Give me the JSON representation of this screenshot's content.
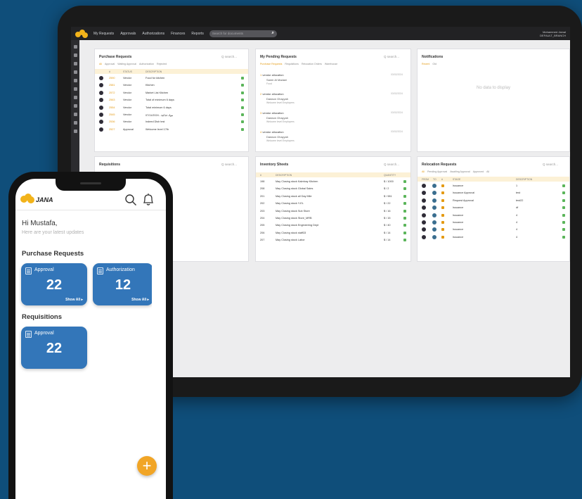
{
  "desktop": {
    "nav": [
      "My Requests",
      "Approvals",
      "Authorizations",
      "Finances",
      "Reports"
    ],
    "search_placeholder": "Search for documents",
    "user": [
      "Mohammed Jamal",
      "DEFAULT_BRANCH"
    ],
    "purchase_requests": {
      "title": "Purchase Requests",
      "search": "Q search...",
      "filters": [
        "All",
        "Approval",
        "Waiting Approval",
        "Authorization",
        "Rejected"
      ],
      "columns": [
        "#",
        "STATUS",
        "DESCRIPTION"
      ],
      "rows": [
        {
          "no": "2590",
          "status": "Vendor",
          "desc": "Food for kitchen"
        },
        {
          "no": "2581",
          "status": "Vendor",
          "desc": "Kitchen"
        },
        {
          "no": "2572",
          "status": "Vendor",
          "desc": "Market List Kitchen"
        },
        {
          "no": "2563",
          "status": "Vendor",
          "desc": "Total of minimum 6 days"
        },
        {
          "no": "2554",
          "status": "Vendor",
          "desc": "Total minimum 6 days"
        },
        {
          "no": "2545",
          "status": "Vendor",
          "desc": "07/11/2024 - مواد غذائية"
        },
        {
          "no": "2536",
          "status": "Vendor",
          "desc": "Indeed Dish test"
        },
        {
          "no": "2527",
          "status": "Approval",
          "desc": "Welcome level 17th"
        }
      ]
    },
    "pending": {
      "title": "My Pending Requests",
      "search": "Q search...",
      "filters": [
        "Purchase Requests",
        "Requisitions",
        "Relocation Orders",
        "Warehouse"
      ],
      "items": [
        {
          "code": "1",
          "title": "vendor allocation",
          "name": "Samir Al Madani",
          "note": "Food",
          "date": "03/02/2024"
        },
        {
          "code": "2",
          "title": "vendor allocation",
          "name": "Dadaon Ghayyah",
          "note": "Welcome level Employees",
          "date": "03/02/2024"
        },
        {
          "code": "3",
          "title": "vendor allocation",
          "name": "Dadaon Ghayyah",
          "note": "Welcome level Employees",
          "date": "03/02/2024"
        },
        {
          "code": "4",
          "title": "vendor allocation",
          "name": "Dadaon Ghayyah",
          "note": "Welcome level Employees",
          "date": "03/02/2024"
        }
      ]
    },
    "notifications": {
      "title": "Notifications",
      "tabs": [
        "Recent",
        "Old"
      ],
      "empty": "No data to display"
    },
    "requisitions": {
      "title": "Requisitions",
      "search": "Q search..."
    },
    "inventory": {
      "title": "Inventory Sheets",
      "search": "Q search...",
      "columns": [
        "#",
        "DESCRIPTION",
        "QUANTITY"
      ],
      "rows": [
        {
          "no": "198",
          "desc": "May Closing stock Kalmbay Kitchen",
          "qty": "$ / 1000"
        },
        {
          "no": "208",
          "desc": "May Closing stock Global Sales",
          "qty": "$ / 2"
        },
        {
          "no": "201",
          "desc": "May Closing stock all Day Mile",
          "qty": "$ / 981"
        },
        {
          "no": "202",
          "desc": "May Closing stock Y-EL",
          "qty": "$ / 22"
        },
        {
          "no": "203",
          "desc": "May Closing stock Sub Store",
          "qty": "$ / 16"
        },
        {
          "no": "204",
          "desc": "May Closing stock Store_MRB",
          "qty": "$ / 15"
        },
        {
          "no": "205",
          "desc": "May Closing stock Engineering Dept",
          "qty": "$ / 40"
        },
        {
          "no": "206",
          "desc": "May Closing stock staff33",
          "qty": "$ / 14"
        },
        {
          "no": "207",
          "desc": "May Closing stock Labor",
          "qty": "$ / 14"
        }
      ]
    },
    "relocation": {
      "title": "Relocation Requests",
      "search": "Q search...",
      "filters": [
        "All",
        "Pending Approval",
        "Awaiting Approval",
        "Approved",
        "All"
      ],
      "columns": [
        "FROM",
        "TO",
        "#",
        "STAGE",
        "DESCRIPTION"
      ],
      "rows": [
        {
          "stage": "Issuance",
          "desc": "1"
        },
        {
          "stage": "Issuance Approval",
          "desc": "test"
        },
        {
          "stage": "Request Approval",
          "desc": "test22"
        },
        {
          "stage": "Issuance",
          "desc": "df"
        },
        {
          "stage": "Issuance",
          "desc": "4"
        },
        {
          "stage": "Issuance",
          "desc": "4"
        },
        {
          "stage": "Issuance",
          "desc": "4"
        },
        {
          "stage": "Issuance",
          "desc": "4"
        }
      ]
    }
  },
  "mobile": {
    "app_name": "JANA",
    "greeting": "Hi Mustafa,",
    "subtitle": "Here are your latest updates",
    "purchase_section": "Purchase Requests",
    "purchase_cards": [
      {
        "label": "Approval",
        "count": "22",
        "action": "Show All ▸"
      },
      {
        "label": "Authorization",
        "count": "12",
        "action": "Show All ▸"
      }
    ],
    "requisitions_section": "Requisitions",
    "requisition_cards": [
      {
        "label": "Approval",
        "count": "22"
      }
    ],
    "fab": "+"
  },
  "colors": {
    "background": "#0f4e7a",
    "accent": "#f1a526",
    "card": "#3376b9",
    "success": "#5bb55a"
  }
}
